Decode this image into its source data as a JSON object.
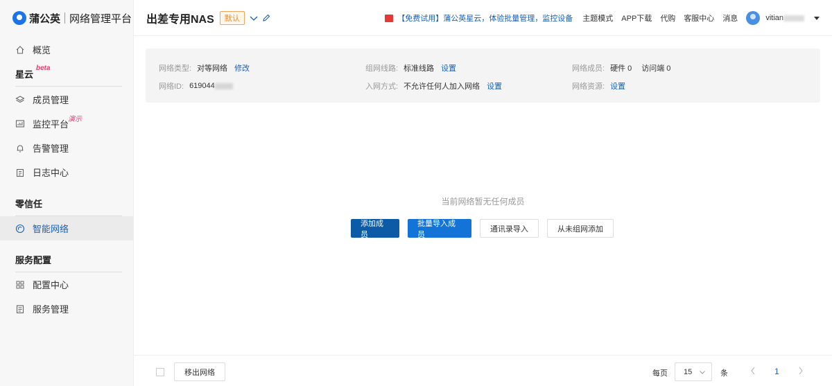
{
  "brand": {
    "name": "蒲公英",
    "subtitle": "网络管理平台"
  },
  "sidebar": {
    "overview": "概览",
    "xingyun": {
      "title": "星云",
      "badge": "beta"
    },
    "member_mgmt": "成员管理",
    "monitor": {
      "label": "监控平台",
      "badge": "演示"
    },
    "alert_mgmt": "告警管理",
    "log_center": "日志中心",
    "zero_trust": "零信任",
    "smart_network": "智能网络",
    "service_config": "服务配置",
    "config_center": "配置中心",
    "service_mgmt": "服务管理"
  },
  "header": {
    "network_name": "出差专用NAS",
    "default_tag": "默认",
    "promo": "【免费试用】蒲公英星云，体验批量管理，监控设备",
    "links": [
      "主题模式",
      "APP下载",
      "代购",
      "客服中心",
      "消息"
    ],
    "user": "vitian"
  },
  "info": {
    "type_label": "网络类型:",
    "type_value": "对等网络",
    "modify": "修改",
    "line_label": "组网线路:",
    "line_value": "标准线路",
    "set": "设置",
    "members_label": "网络成员:",
    "hardware": "硬件 0",
    "visitors": "访问端 0",
    "id_label": "网络ID:",
    "id_value": "619044",
    "join_label": "入网方式:",
    "join_value": "不允许任何人加入网络",
    "resources_label": "网络资源:"
  },
  "empty": {
    "message": "当前网络暂无任何成员",
    "add_member": "添加成员",
    "batch_import": "批量导入成员",
    "contacts_import": "通讯录导入",
    "from_ungrouped": "从未组网添加"
  },
  "footer": {
    "remove": "移出网络",
    "per_page": "每页",
    "page_size": "15",
    "unit": "条",
    "current_page": "1"
  },
  "colors": {
    "accent": "#1473d6",
    "accent_dark": "#0d5aa7",
    "promo_icon": "#e53935",
    "tag": "#f08c2a"
  }
}
